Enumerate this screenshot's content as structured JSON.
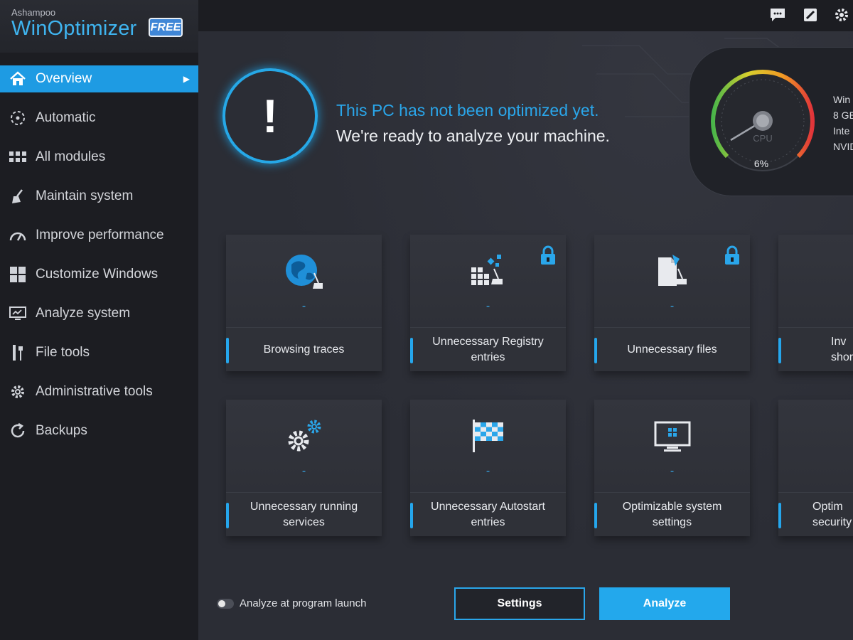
{
  "app": {
    "brand": "Ashampoo",
    "product": "WinOptimizer",
    "edition_badge": "FREE"
  },
  "toolbar": {
    "icons": [
      "feedback-icon",
      "edit-icon",
      "gear-icon"
    ]
  },
  "sidebar": {
    "items": [
      {
        "label": "Overview",
        "icon": "home-icon",
        "active": true
      },
      {
        "label": "Automatic",
        "icon": "automatic-icon"
      },
      {
        "label": "All modules",
        "icon": "grid-icon"
      },
      {
        "label": "Maintain system",
        "icon": "broom-icon"
      },
      {
        "label": "Improve performance",
        "icon": "speedometer-icon"
      },
      {
        "label": "Customize Windows",
        "icon": "windows-icon"
      },
      {
        "label": "Analyze system",
        "icon": "monitor-icon"
      },
      {
        "label": "File tools",
        "icon": "tools-icon"
      },
      {
        "label": "Administrative tools",
        "icon": "gear-icon"
      },
      {
        "label": "Backups",
        "icon": "backup-icon"
      }
    ]
  },
  "status": {
    "title": "This PC has not been optimized yet.",
    "subtitle": "We're ready to analyze your machine."
  },
  "gauge": {
    "label": "CPU",
    "value_text": "6%",
    "value": 6,
    "info_lines": [
      "Win",
      "8 GE",
      "Inte",
      "NVID"
    ]
  },
  "tiles": [
    {
      "label": "Browsing traces",
      "value": "-",
      "icon": "globe-broom-icon",
      "locked": false
    },
    {
      "label": "Unnecessary Registry entries",
      "value": "-",
      "icon": "registry-broom-icon",
      "locked": true
    },
    {
      "label": "Unnecessary files",
      "value": "-",
      "icon": "file-broom-icon",
      "locked": true
    },
    {
      "label": "Inv shor",
      "value": "-",
      "icon": "shortcut-icon",
      "locked": false
    },
    {
      "label": "Unnecessary running services",
      "value": "-",
      "icon": "gears-icon",
      "locked": false
    },
    {
      "label": "Unnecessary Autostart entries",
      "value": "-",
      "icon": "checkered-flag-icon",
      "locked": false
    },
    {
      "label": "Optimizable system settings",
      "value": "-",
      "icon": "monitor-windows-icon",
      "locked": false
    },
    {
      "label": "Optim security",
      "value": "-",
      "icon": "shield-icon",
      "locked": false
    }
  ],
  "footer": {
    "toggle_label": "Analyze at program launch",
    "toggle_on": false,
    "settings_label": "Settings",
    "analyze_label": "Analyze"
  },
  "colors": {
    "accent": "#1e9be3",
    "sidebar_bg": "#1c1d22",
    "main_bg": "#2b2d35"
  }
}
